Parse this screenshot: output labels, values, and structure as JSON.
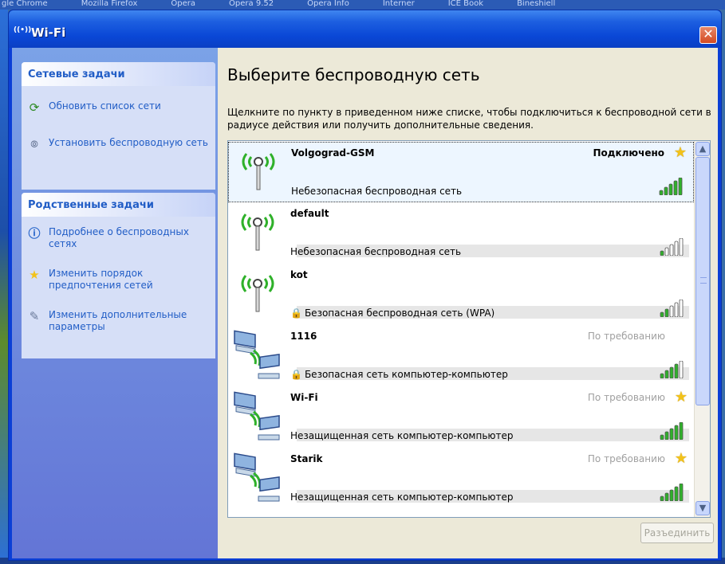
{
  "background_tabs": [
    "gle Chrome",
    "Mozilla Firefox",
    "Opera",
    "Opera 9.52",
    "Opera Info",
    "Interner",
    "ICE Book",
    "Bineshiell"
  ],
  "window": {
    "title": "Wi-Fi",
    "title_icon": "wifi-icon",
    "close_label": "✕"
  },
  "task_pane": {
    "network_tasks": {
      "header": "Сетевые задачи",
      "items": [
        {
          "label": "Обновить список сети",
          "icon": "refresh-icon"
        },
        {
          "label": "Установить беспроводную сеть",
          "icon": "wireless-setup-icon"
        }
      ]
    },
    "related_tasks": {
      "header": "Родственные задачи",
      "items": [
        {
          "label": "Подробнее о беспроводных сетях",
          "icon": "info-icon"
        },
        {
          "label": "Изменить порядок предпочтения сетей",
          "icon": "star-icon"
        },
        {
          "label": "Изменить дополнительные параметры",
          "icon": "settings-icon"
        }
      ]
    }
  },
  "main": {
    "heading": "Выберите беспроводную сеть",
    "description": "Щелкните по пункту в приведенном ниже списке, чтобы подключиться к беспроводной сети в радиусе действия или получить дополнительные сведения.",
    "disconnect_label": "Разъединить"
  },
  "networks": [
    {
      "name": "Volgograd-GSM",
      "status": "Подключено",
      "starred": true,
      "secured": false,
      "security": "Небезопасная беспроводная сеть",
      "type": "access-point",
      "signal_bars": 5,
      "selected": true
    },
    {
      "name": "default",
      "status": "",
      "starred": false,
      "secured": false,
      "security": "Небезопасная беспроводная сеть",
      "type": "access-point",
      "signal_bars": 1,
      "selected": false
    },
    {
      "name": "kot",
      "status": "",
      "starred": false,
      "secured": true,
      "security": "Безопасная беспроводная сеть (WPA)",
      "type": "access-point",
      "signal_bars": 2,
      "selected": false
    },
    {
      "name": "1116",
      "status": "По требованию",
      "starred": false,
      "secured": true,
      "security": "Безопасная сеть компьютер-компьютер",
      "type": "ad-hoc",
      "signal_bars": 4,
      "selected": false
    },
    {
      "name": "Wi-Fi",
      "status": "По требованию",
      "starred": true,
      "secured": false,
      "security": "Незащищенная сеть компьютер-компьютер",
      "type": "ad-hoc",
      "signal_bars": 5,
      "selected": false
    },
    {
      "name": "Starik",
      "status": "По требованию",
      "starred": true,
      "secured": false,
      "security": "Незащищенная сеть компьютер-компьютер",
      "type": "ad-hoc",
      "signal_bars": 5,
      "selected": false
    }
  ],
  "colors": {
    "signal_on": "#2fb12a",
    "signal_off": "#ffffff",
    "link": "#215dc6",
    "star": "#f2c21a",
    "titlebar": "#0a47d6"
  }
}
